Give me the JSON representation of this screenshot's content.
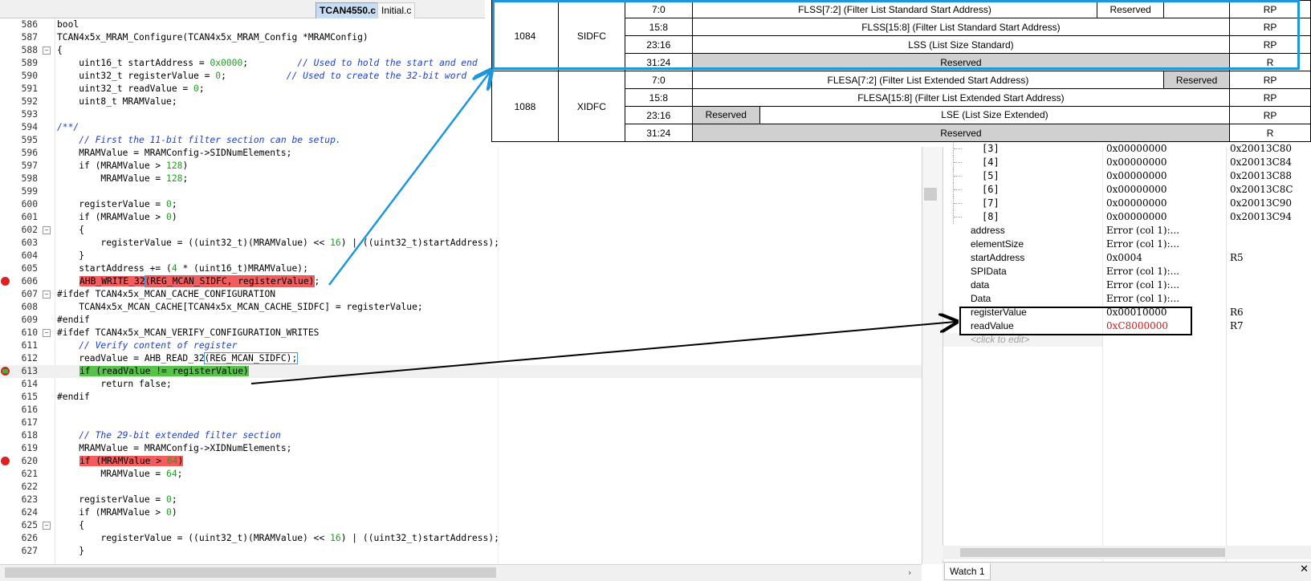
{
  "tabs": {
    "active": "TCAN4550.c",
    "inactive": "Initial.c"
  },
  "code": {
    "l586": {
      "n": "586",
      "t": "bool"
    },
    "l587": {
      "n": "587",
      "t": "TCAN4x5x_MRAM_Configure(TCAN4x5x_MRAM_Config *MRAMConfig)"
    },
    "l588": {
      "n": "588",
      "t": "{"
    },
    "l589": {
      "n": "589",
      "a": "    uint16_t startAddress = ",
      "v": "0x0000",
      "b": ";         ",
      "c": "// Used to hold the start and end"
    },
    "l590": {
      "n": "590",
      "a": "    uint32_t registerValue = ",
      "v": "0",
      "b": ";           ",
      "c": "// Used to create the 32-bit word"
    },
    "l591": {
      "n": "591",
      "a": "    uint32_t readValue = ",
      "v": "0",
      "b": ";"
    },
    "l592": {
      "n": "592",
      "t": "    uint8_t MRAMValue;"
    },
    "l593": {
      "n": "593",
      "t": ""
    },
    "l594": {
      "n": "594",
      "c": "/**/"
    },
    "l595": {
      "n": "595",
      "c": "    // First the 11-bit filter section can be setup."
    },
    "l596": {
      "n": "596",
      "t": "    MRAMValue = MRAMConfig->SIDNumElements;"
    },
    "l597": {
      "n": "597",
      "a": "    if (MRAMValue > ",
      "v": "128",
      "b": ")"
    },
    "l598": {
      "n": "598",
      "a": "        MRAMValue = ",
      "v": "128",
      "b": ";"
    },
    "l599": {
      "n": "599",
      "t": ""
    },
    "l600": {
      "n": "600",
      "a": "    registerValue = ",
      "v": "0",
      "b": ";"
    },
    "l601": {
      "n": "601",
      "a": "    if (MRAMValue > ",
      "v": "0",
      "b": ")"
    },
    "l602": {
      "n": "602",
      "t": "    {"
    },
    "l603": {
      "n": "603",
      "a": "        registerValue = ((uint32_t)(MRAMValue) << ",
      "v": "16",
      "b": ") | ((uint32_t)startAddress);"
    },
    "l604": {
      "n": "604",
      "t": "    }"
    },
    "l605": {
      "n": "605",
      "a": "    startAddress += (",
      "v": "4",
      "b": " * (uint16_t)MRAMValue);"
    },
    "l606": {
      "n": "606",
      "a": "AHB_WRITE_32",
      "v": "(REG_MCAN_SIDFC, registerValue)",
      "b": ";"
    },
    "l607": {
      "n": "607",
      "t": "#ifdef TCAN4x5x_MCAN_CACHE_CONFIGURATION"
    },
    "l608": {
      "n": "608",
      "t": "    TCAN4x5x_MCAN_CACHE[TCAN4x5x_MCAN_CACHE_SIDFC] = registerValue;"
    },
    "l609": {
      "n": "609",
      "t": "#endif"
    },
    "l610": {
      "n": "610",
      "t": "#ifdef TCAN4x5x_MCAN_VERIFY_CONFIGURATION_WRITES"
    },
    "l611": {
      "n": "611",
      "c": "    // Verify content of register"
    },
    "l612": {
      "n": "612",
      "a": "    readValue = AHB_READ_32",
      "v": "(REG_MCAN_SIDFC);"
    },
    "l613": {
      "n": "613",
      "v": "if (readValue != registerValue)"
    },
    "l614": {
      "n": "614",
      "t": "        return false;"
    },
    "l615": {
      "n": "615",
      "t": "#endif"
    },
    "l616": {
      "n": "616",
      "t": ""
    },
    "l617": {
      "n": "617",
      "t": ""
    },
    "l618": {
      "n": "618",
      "c": "    // The 29-bit extended filter section"
    },
    "l619": {
      "n": "619",
      "t": "    MRAMValue = MRAMConfig->XIDNumElements;"
    },
    "l620": {
      "n": "620",
      "a": "if (MRAMValue > ",
      "v": "64",
      "b": ")"
    },
    "l621": {
      "n": "621",
      "a": "        MRAMValue = ",
      "v": "64",
      "b": ";"
    },
    "l622": {
      "n": "622",
      "t": ""
    },
    "l623": {
      "n": "623",
      "a": "    registerValue = ",
      "v": "0",
      "b": ";"
    },
    "l624": {
      "n": "624",
      "a": "    if (MRAMValue > ",
      "v": "0",
      "b": ")"
    },
    "l625": {
      "n": "625",
      "t": "    {"
    },
    "l626": {
      "n": "626",
      "a": "        registerValue = ((uint32_t)(MRAMValue) << ",
      "v": "16",
      "b": ") | ((uint32_t)startAddress);"
    },
    "l627": {
      "n": "627",
      "t": "    }"
    }
  },
  "register_table": {
    "sidfc": {
      "offset": "1084",
      "name": "SIDFC",
      "r1": {
        "bits": "7:0",
        "field": "FLSS[7:2] (Filter List Standard Start Address)",
        "res": "Reserved",
        "acc": "RP"
      },
      "r2": {
        "bits": "15:8",
        "field": "FLSS[15:8] (Filter List Standard Start Address)",
        "acc": "RP"
      },
      "r3": {
        "bits": "23:16",
        "field": "LSS (List Size Standard)",
        "acc": "RP"
      },
      "r4": {
        "bits": "31:24",
        "field": "Reserved",
        "acc": "R"
      }
    },
    "xidfc": {
      "offset": "1088",
      "name": "XIDFC",
      "r1": {
        "bits": "7:0",
        "field": "FLESA[7:2] (Filter List Extended Start Address)",
        "res": "Reserved",
        "acc": "RP"
      },
      "r2": {
        "bits": "15:8",
        "field": "FLESA[15:8] (Filter List Extended Start Address)",
        "acc": "RP"
      },
      "r3": {
        "bits": "23:16",
        "res": "Reserved",
        "field": "LSE (List Size Extended)",
        "acc": "RP"
      },
      "r4": {
        "bits": "31:24",
        "field": "Reserved",
        "acc": "R"
      }
    }
  },
  "watch": {
    "a3": {
      "name": "[3]",
      "val": "0x00000000",
      "addr": "0x20013C80"
    },
    "a4": {
      "name": "[4]",
      "val": "0x00000000",
      "addr": "0x20013C84"
    },
    "a5": {
      "name": "[5]",
      "val": "0x00000000",
      "addr": "0x20013C88"
    },
    "a6": {
      "name": "[6]",
      "val": "0x00000000",
      "addr": "0x20013C8C"
    },
    "a7": {
      "name": "[7]",
      "val": "0x00000000",
      "addr": "0x20013C90"
    },
    "a8": {
      "name": "[8]",
      "val": "0x00000000",
      "addr": "0x20013C94"
    },
    "address": {
      "name": "address",
      "val": "Error (col 1):...",
      "loc": ""
    },
    "elementSize": {
      "name": "elementSize",
      "val": "Error (col 1):...",
      "loc": ""
    },
    "startAddress": {
      "name": "startAddress",
      "val": "0x0004",
      "loc": "R5"
    },
    "SPIData": {
      "name": "SPIData",
      "val": "Error (col 1):...",
      "loc": ""
    },
    "data": {
      "name": "data",
      "val": "Error (col 1):...",
      "loc": ""
    },
    "Data": {
      "name": "Data",
      "val": "Error (col 1):...",
      "loc": ""
    },
    "registerValue": {
      "name": "registerValue",
      "val": "0x00010000",
      "loc": "R6"
    },
    "readValue": {
      "name": "readValue",
      "val": "0xC8000000",
      "loc": "R7"
    },
    "click_edit": "<click to edit>",
    "tab": "Watch 1",
    "close": "✕"
  },
  "colors": {
    "breakpoint": "#e02020",
    "highlight_red": "#f25c5c",
    "highlight_green": "#57c24a",
    "annotation_blue": "#1e96db",
    "error_red": "#e01010"
  }
}
